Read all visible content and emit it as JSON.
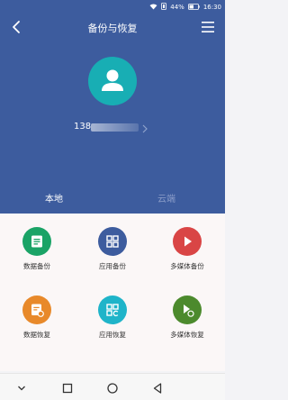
{
  "status_bar": {
    "battery": "44%",
    "time": "16:30"
  },
  "header": {
    "title": "备份与恢复"
  },
  "account": {
    "phone_prefix": "138"
  },
  "tabs": [
    {
      "label": "本地",
      "active": true
    },
    {
      "label": "云端",
      "active": false
    }
  ],
  "actions": {
    "data_backup": {
      "label": "数据备份",
      "color": "#1aa366",
      "icon": "document-icon"
    },
    "app_backup": {
      "label": "应用备份",
      "color": "#3d5c9e",
      "icon": "grid-icon"
    },
    "media_backup": {
      "label": "多媒体备份",
      "color": "#d94545",
      "icon": "play-icon"
    },
    "data_restore": {
      "label": "数据恢复",
      "color": "#e8892a",
      "icon": "document-restore-icon"
    },
    "app_restore": {
      "label": "应用恢复",
      "color": "#1fb4c9",
      "icon": "grid-restore-icon"
    },
    "media_restore": {
      "label": "多媒体恢复",
      "color": "#4c8a2d",
      "icon": "play-restore-icon"
    }
  }
}
